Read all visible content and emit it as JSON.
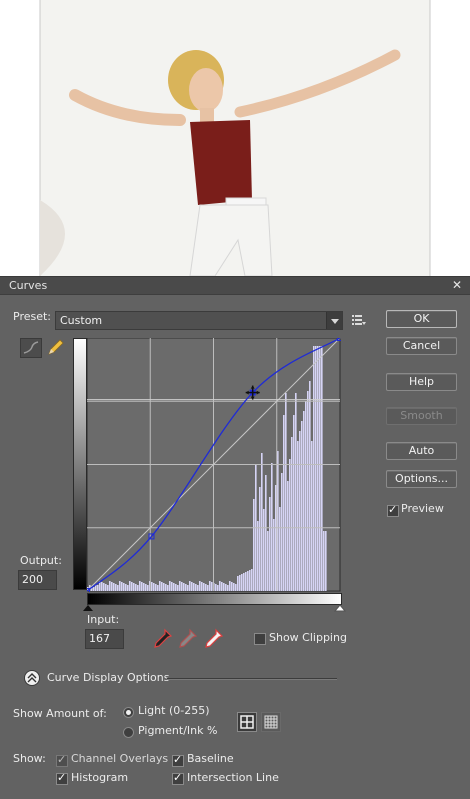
{
  "dialog": {
    "title": "Curves"
  },
  "preset": {
    "label": "Preset:",
    "value": "Custom"
  },
  "buttons": {
    "ok": "OK",
    "cancel": "Cancel",
    "help": "Help",
    "smooth": "Smooth",
    "auto": "Auto",
    "options": "Options..."
  },
  "preview": {
    "label": "Preview",
    "checked": true
  },
  "output": {
    "label": "Output:",
    "value": "200"
  },
  "input": {
    "label": "Input:",
    "value": "167"
  },
  "show_clipping": {
    "label": "Show Clipping",
    "checked": false
  },
  "curve_display": {
    "label": "Curve Display Options"
  },
  "show_amount": {
    "label": "Show Amount of:",
    "options": [
      {
        "label": "Light  (0-255)",
        "selected": true
      },
      {
        "label": "Pigment/Ink %",
        "selected": false
      }
    ]
  },
  "show": {
    "label": "Show:",
    "channel_overlays": {
      "label": "Channel Overlays",
      "checked": true,
      "disabled": true
    },
    "baseline": {
      "label": "Baseline",
      "checked": true
    },
    "histogram": {
      "label": "Histogram",
      "checked": true
    },
    "intersection_line": {
      "label": "Intersection Line",
      "checked": true
    }
  },
  "curve": {
    "points": [
      [
        0,
        0
      ],
      [
        65,
        55
      ],
      [
        167,
        200
      ],
      [
        255,
        255
      ]
    ]
  },
  "colors": {
    "dialog_bg": "#626262",
    "curve": "#1f2bd6",
    "histogram": "#d6d4f5",
    "graph_bg": "#6b6b6b"
  },
  "icons": [
    "curve-tool-icon",
    "pencil-icon",
    "preset-menu-icon",
    "black-eyedropper-icon",
    "gray-eyedropper-icon",
    "white-eyedropper-icon",
    "grid-coarse-icon",
    "grid-fine-icon",
    "expand-icon"
  ]
}
